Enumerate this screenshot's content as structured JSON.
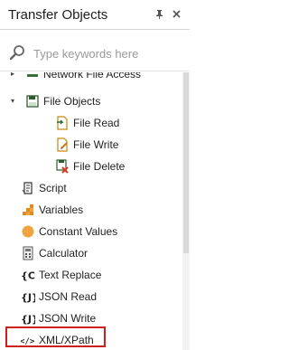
{
  "panel": {
    "title": "Transfer Objects",
    "pin_icon": "pin-icon",
    "close_icon": "close-icon"
  },
  "search": {
    "placeholder": "Type keywords here",
    "value": "",
    "icon": "search-icon"
  },
  "tree": {
    "items": [
      {
        "label": "Network File Access",
        "icon": "network-file-icon",
        "level": 1,
        "expandable": true,
        "expanded": false
      },
      {
        "label": "File Objects",
        "icon": "file-objects-icon",
        "level": 1,
        "expandable": true,
        "expanded": true
      },
      {
        "label": "File Read",
        "icon": "file-read-icon",
        "level": 2
      },
      {
        "label": "File Write",
        "icon": "file-write-icon",
        "level": 2
      },
      {
        "label": "File Delete",
        "icon": "file-delete-icon",
        "level": 2
      },
      {
        "label": "Script",
        "icon": "script-icon",
        "level": 1
      },
      {
        "label": "Variables",
        "icon": "variables-icon",
        "level": 1
      },
      {
        "label": "Constant Values",
        "icon": "constant-values-icon",
        "level": 1
      },
      {
        "label": "Calculator",
        "icon": "calculator-icon",
        "level": 1
      },
      {
        "label": "Text Replace",
        "icon": "text-replace-icon",
        "level": 1
      },
      {
        "label": "JSON Read",
        "icon": "json-read-icon",
        "level": 1
      },
      {
        "label": "JSON Write",
        "icon": "json-write-icon",
        "level": 1
      },
      {
        "label": "XML/XPath",
        "icon": "xml-xpath-icon",
        "level": 1,
        "highlighted": true
      }
    ]
  },
  "colors": {
    "highlight_border": "#d01f1f",
    "file_icon_accent": "#e0a21b",
    "constant_values_dot": "#f0a440",
    "variables_icon": "#e8891d"
  }
}
